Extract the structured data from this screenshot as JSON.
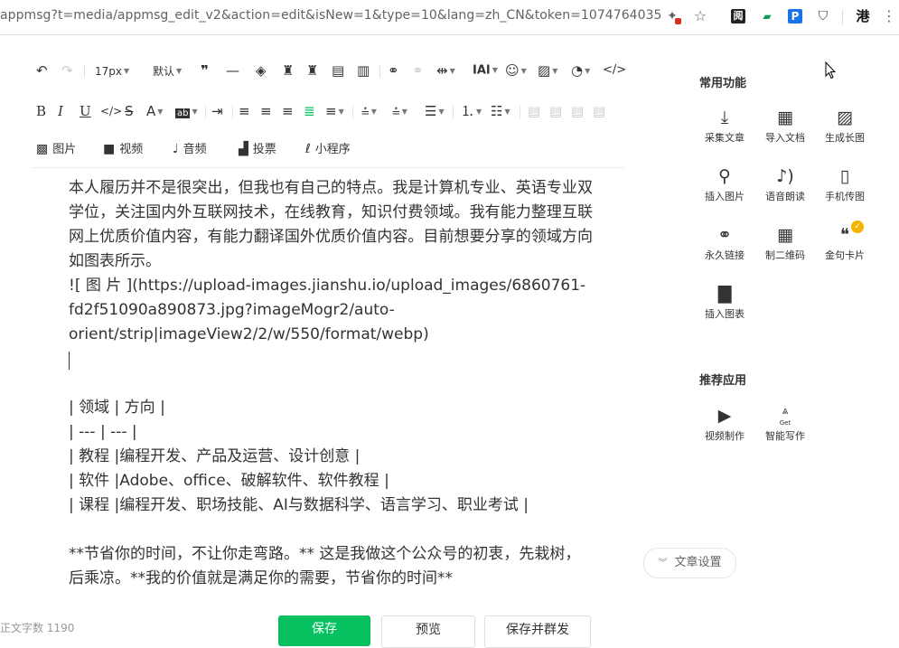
{
  "browser": {
    "url": "appmsg?t=media/appmsg_edit_v2&action=edit&isNew=1&type=10&lang=zh_CN&token=1074764035",
    "ext_gang": "港"
  },
  "toolbar": {
    "font_size": "17px",
    "line_height": "默认"
  },
  "media_bar": {
    "image": "图片",
    "video": "视频",
    "audio": "音频",
    "vote": "投票",
    "miniprogram": "小程序"
  },
  "editor": {
    "para1": "本人履历并不是很突出，但我也有自己的特点。我是计算机专业、英语专业双学位，关注国内外互联网技术，在线教育，知识付费领域。我有能力整理互联网上优质价值内容，有能力翻译国外优质价值内容。目前想要分享的领域方向如图表所示。",
    "img_line1": "![ 图 片 ](https://upload-images.jianshu.io/upload_images/6860761-",
    "img_line2": "fd2f51090a890873.jpg?imageMogr2/auto-",
    "img_line3": "orient/strip|imageView2/2/w/550/format/webp)",
    "table_rows": [
      "| 领域 | 方向  |",
      "| --- | --- |",
      "| 教程 |编程开发、产品及运营、设计创意 |",
      "| 软件 |Adobe、office、破解软件、软件教程  |",
      "| 课程 |编程开发、职场技能、AI与数据科学、语言学习、职业考试   |"
    ],
    "closing1": "**节省你的时间，不让你走弯路。** 这是我做这个公众号的初衷，先栽树，",
    "closing2": "后乘凉。**我的价值就是满足你的需要，节省你的时间**"
  },
  "bottom": {
    "word_count": "正文字数  1190",
    "save": "保存",
    "preview": "预览",
    "save_mass": "保存并群发"
  },
  "panel": {
    "common_title": "常用功能",
    "features": [
      {
        "label": "采集文章",
        "icon": "collect-icon"
      },
      {
        "label": "导入文档",
        "icon": "word-import-icon"
      },
      {
        "label": "生成长图",
        "icon": "long-image-icon"
      },
      {
        "label": "插入图片",
        "icon": "search-icon"
      },
      {
        "label": "语音朗读",
        "icon": "voice-read-icon"
      },
      {
        "label": "手机传图",
        "icon": "phone-upload-icon"
      },
      {
        "label": "永久链接",
        "icon": "link-icon"
      },
      {
        "label": "制二维码",
        "icon": "qrcode-icon"
      },
      {
        "label": "金句卡片",
        "icon": "quote-card-icon"
      },
      {
        "label": "插入图表",
        "icon": "bar-chart-icon"
      }
    ],
    "recommend_title": "推荐应用",
    "apps": [
      {
        "label": "视频制作",
        "icon": "video-make-icon"
      },
      {
        "label": "智能写作",
        "icon": "ai-write-icon",
        "sub": "Get"
      }
    ],
    "article_settings": "文章设置"
  }
}
